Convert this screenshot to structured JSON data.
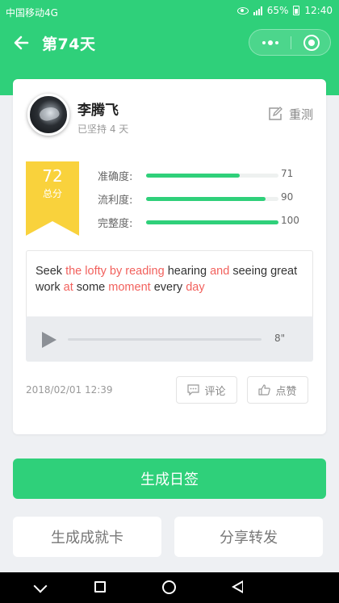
{
  "status_bar": {
    "carrier": "中国移动4G",
    "battery": "65%",
    "time": "12:40"
  },
  "nav": {
    "title": "第74天",
    "icons": [
      "back-arrow-icon",
      "more-dots-icon",
      "close-circle-icon"
    ]
  },
  "profile": {
    "name": "李腾飞",
    "streak": "已坚持 4 天",
    "retest_label": "重测"
  },
  "score": {
    "value": "72",
    "label": "总分",
    "ribbon_color": "#f9d23c"
  },
  "metrics": [
    {
      "label": "准确度:",
      "value": "71",
      "fraction": 0.71
    },
    {
      "label": "流利度:",
      "value": "90",
      "fraction": 0.9
    },
    {
      "label": "完整度:",
      "value": "100",
      "fraction": 1.0
    }
  ],
  "sentence": {
    "words": [
      {
        "text": "Seek",
        "hl": false
      },
      {
        "text": "the",
        "hl": true
      },
      {
        "text": "lofty",
        "hl": true
      },
      {
        "text": "by",
        "hl": true
      },
      {
        "text": "reading",
        "hl": true
      },
      {
        "text": "hearing",
        "hl": false
      },
      {
        "text": "and",
        "hl": true
      },
      {
        "text": "seeing",
        "hl": false
      },
      {
        "text": "great",
        "hl": false
      },
      {
        "text": "work",
        "hl": false
      },
      {
        "text": "at",
        "hl": true
      },
      {
        "text": "some",
        "hl": false
      },
      {
        "text": "moment",
        "hl": true
      },
      {
        "text": "every",
        "hl": false
      },
      {
        "text": "day",
        "hl": true
      }
    ],
    "highlight_color": "#f2615d"
  },
  "audio": {
    "duration": "8\"",
    "progress": 0.0
  },
  "post": {
    "timestamp": "2018/02/01 12:39",
    "comment_label": "评论",
    "like_label": "点赞"
  },
  "actions": {
    "primary": "生成日签",
    "achievement": "生成成就卡",
    "share": "分享转发"
  },
  "colors": {
    "accent": "#2fd07a",
    "page_bg": "#eef0f3"
  }
}
